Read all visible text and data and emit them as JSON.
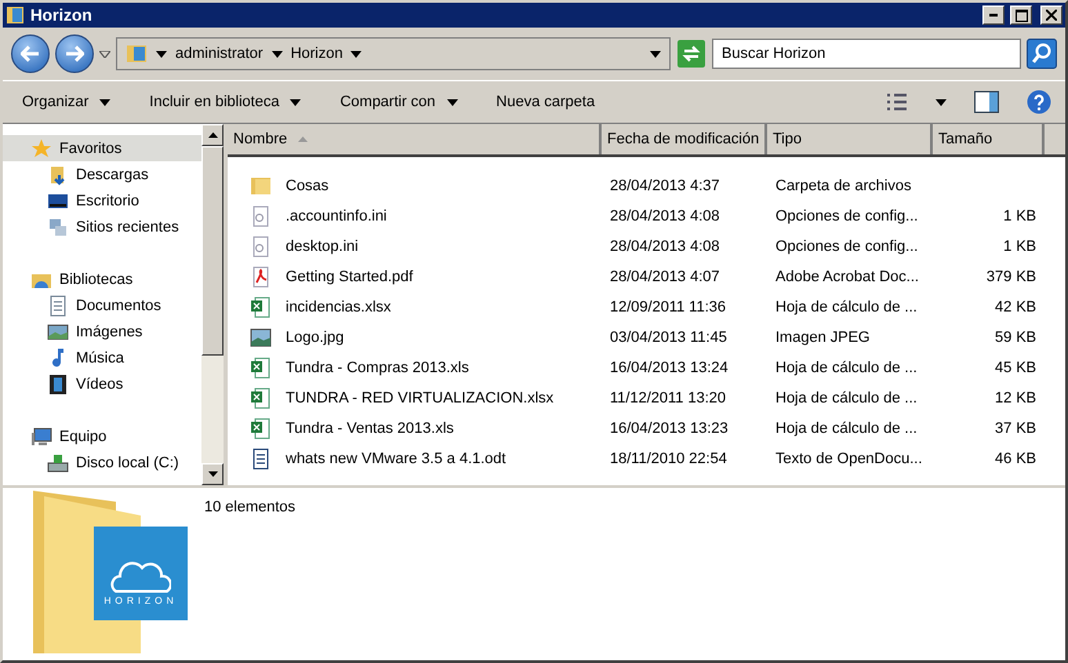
{
  "window": {
    "title": "Horizon"
  },
  "address": {
    "crumbs": [
      "administrator",
      "Horizon"
    ]
  },
  "search": {
    "placeholder": "Buscar Horizon"
  },
  "toolbar": [
    {
      "label": "Organizar",
      "dropdown": true
    },
    {
      "label": "Incluir en biblioteca",
      "dropdown": true
    },
    {
      "label": "Compartir con",
      "dropdown": true
    },
    {
      "label": "Nueva carpeta",
      "dropdown": false
    }
  ],
  "sidebar": {
    "items": [
      {
        "label": "Favoritos",
        "kind": "star",
        "selected": true,
        "children": [
          {
            "label": "Descargas",
            "kind": "download",
            "selected": false
          },
          {
            "label": "Escritorio",
            "kind": "desktop",
            "selected": false
          },
          {
            "label": "Sitios recientes",
            "kind": "recent",
            "selected": false
          }
        ]
      },
      {
        "label": "Bibliotecas",
        "kind": "library",
        "selected": false,
        "children": [
          {
            "label": "Documentos",
            "kind": "doc",
            "selected": false
          },
          {
            "label": "Imágenes",
            "kind": "image",
            "selected": false
          },
          {
            "label": "Música",
            "kind": "music",
            "selected": false
          },
          {
            "label": "Vídeos",
            "kind": "video",
            "selected": false
          }
        ]
      },
      {
        "label": "Equipo",
        "kind": "computer",
        "selected": false,
        "children": [
          {
            "label": "Disco local (C:)",
            "kind": "disk",
            "selected": false
          }
        ]
      }
    ]
  },
  "table": {
    "columns": [
      "Nombre",
      "Fecha de modificación",
      "Tipo",
      "Tamaño"
    ],
    "rows": [
      {
        "kind": "folder",
        "name": "Cosas",
        "date": "28/04/2013 4:37",
        "type": "Carpeta de archivos",
        "size": ""
      },
      {
        "kind": "ini",
        "name": ".accountinfo.ini",
        "date": "28/04/2013 4:08",
        "type": "Opciones de config...",
        "size": "1 KB"
      },
      {
        "kind": "ini",
        "name": "desktop.ini",
        "date": "28/04/2013 4:08",
        "type": "Opciones de config...",
        "size": "1 KB"
      },
      {
        "kind": "pdf",
        "name": "Getting Started.pdf",
        "date": "28/04/2013 4:07",
        "type": "Adobe Acrobat Doc...",
        "size": "379 KB"
      },
      {
        "kind": "excel",
        "name": "incidencias.xlsx",
        "date": "12/09/2011 11:36",
        "type": "Hoja de cálculo de ...",
        "size": "42 KB"
      },
      {
        "kind": "image",
        "name": "Logo.jpg",
        "date": "03/04/2013 11:45",
        "type": "Imagen JPEG",
        "size": "59 KB"
      },
      {
        "kind": "excel",
        "name": "Tundra - Compras 2013.xls",
        "date": "16/04/2013 13:24",
        "type": "Hoja de cálculo de ...",
        "size": "45 KB"
      },
      {
        "kind": "excel",
        "name": "TUNDRA - RED VIRTUALIZACION.xlsx",
        "date": "11/12/2011 13:20",
        "type": "Hoja de cálculo de ...",
        "size": "12 KB"
      },
      {
        "kind": "excel",
        "name": "Tundra - Ventas 2013.xls",
        "date": "16/04/2013 13:23",
        "type": "Hoja de cálculo de ...",
        "size": "37 KB"
      },
      {
        "kind": "odt",
        "name": "whats new VMware 3.5 a 4.1.odt",
        "date": "18/11/2010 22:54",
        "type": "Texto de OpenDocu...",
        "size": "46 KB"
      }
    ]
  },
  "details": {
    "count": "10 elementos",
    "logo_text": "HORIZON"
  }
}
